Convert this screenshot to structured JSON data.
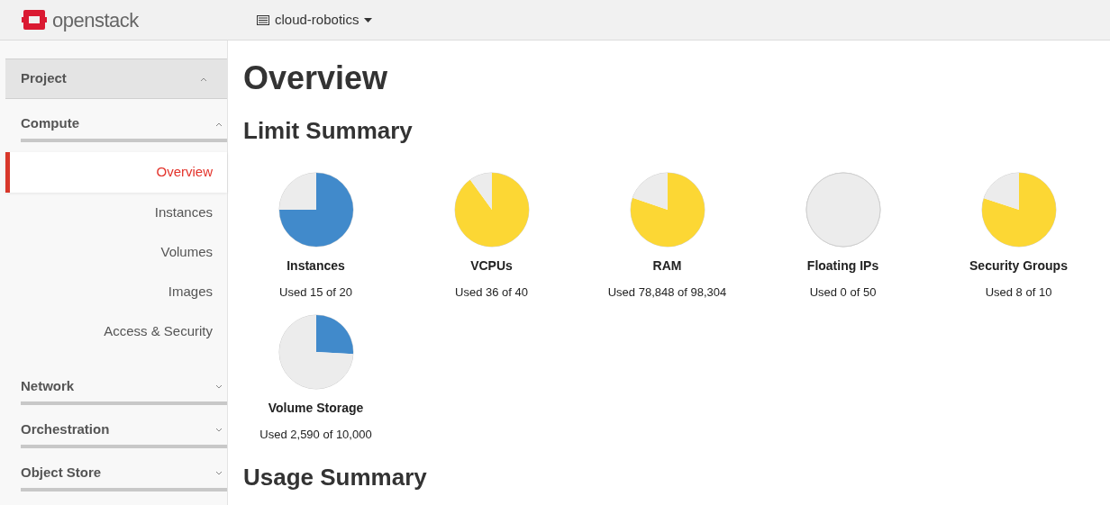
{
  "header": {
    "logo_text": "openstack",
    "project_selector": "cloud-robotics"
  },
  "sidebar": {
    "panels": [
      {
        "label": "Project",
        "kind": "dashboard",
        "expanded": true
      },
      {
        "label": "Compute",
        "kind": "group",
        "expanded": true,
        "items": [
          {
            "label": "Overview",
            "selected": true
          },
          {
            "label": "Instances",
            "selected": false
          },
          {
            "label": "Volumes",
            "selected": false
          },
          {
            "label": "Images",
            "selected": false
          },
          {
            "label": "Access & Security",
            "selected": false
          }
        ]
      },
      {
        "label": "Network",
        "kind": "group",
        "expanded": false
      },
      {
        "label": "Orchestration",
        "kind": "group",
        "expanded": false
      },
      {
        "label": "Object Store",
        "kind": "group",
        "expanded": false
      }
    ]
  },
  "page_title": "Overview",
  "limit_summary": {
    "title": "Limit Summary",
    "pies": [
      {
        "name": "Instances",
        "used": "Used 15 of 20",
        "color": "#418acb",
        "chart_data": {
          "type": "pie",
          "values": [
            75,
            25
          ]
        }
      },
      {
        "name": "VCPUs",
        "used": "Used 36 of 40",
        "color": "#fcd734",
        "chart_data": {
          "type": "pie",
          "values": [
            90,
            10
          ]
        }
      },
      {
        "name": "RAM",
        "used": "Used 78,848 of 98,304",
        "color": "#fcd734",
        "chart_data": {
          "type": "pie",
          "values": [
            80.2,
            19.8
          ]
        }
      },
      {
        "name": "Floating IPs",
        "used": "Used 0 of 50",
        "chart_data": {
          "type": "pie",
          "values": [
            0,
            100
          ]
        }
      },
      {
        "name": "Security Groups",
        "used": "Used 8 of 10",
        "color": "#fcd734",
        "chart_data": {
          "type": "pie",
          "values": [
            80,
            20
          ]
        }
      },
      {
        "name": "Volume Storage",
        "used": "Used 2,590 of 10,000",
        "color": "#418acb",
        "chart_data": {
          "type": "pie",
          "values": [
            25.9,
            74.1
          ]
        }
      }
    ]
  },
  "usage_summary": {
    "title": "Usage Summary"
  }
}
